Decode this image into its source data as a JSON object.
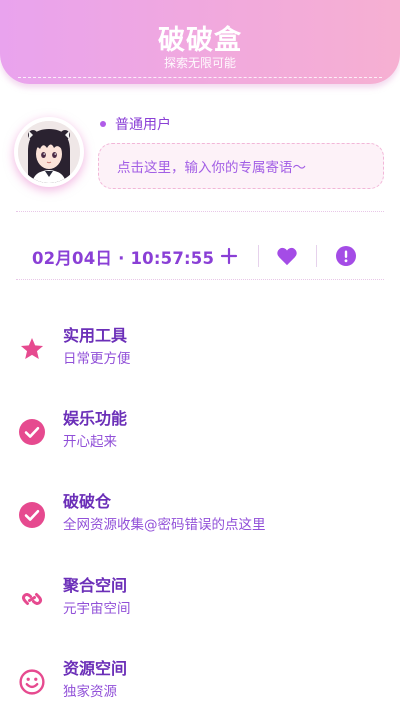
{
  "header": {
    "title": "破破盒",
    "subtitle": "探索无限可能"
  },
  "profile": {
    "user_type": "普通用户",
    "motto_placeholder": "点击这里，输入你的专属寄语～"
  },
  "status": {
    "datetime": "02月04日 · 10:57:55",
    "add_icon": "plus-icon",
    "like_icon": "heart-icon",
    "info_icon": "alert-icon"
  },
  "menu": [
    {
      "title": "实用工具",
      "desc": "日常更方便",
      "icon": "star-icon"
    },
    {
      "title": "娱乐功能",
      "desc": "开心起来",
      "icon": "check-circle-icon"
    },
    {
      "title": "破破仓",
      "desc": "全网资源收集@密码错误的点这里",
      "icon": "check-circle-icon"
    },
    {
      "title": "聚合空间",
      "desc": "元宇宙空间",
      "icon": "link-icon"
    },
    {
      "title": "资源空间",
      "desc": "独家资源",
      "icon": "smile-icon"
    }
  ],
  "colors": {
    "header_gradient_start": "#e9a3ee",
    "header_gradient_end": "#f6b0d2",
    "accent_purple": "#8a3fd6",
    "accent_pink": "#e8479a",
    "icon_pink": "#e64a8f"
  }
}
